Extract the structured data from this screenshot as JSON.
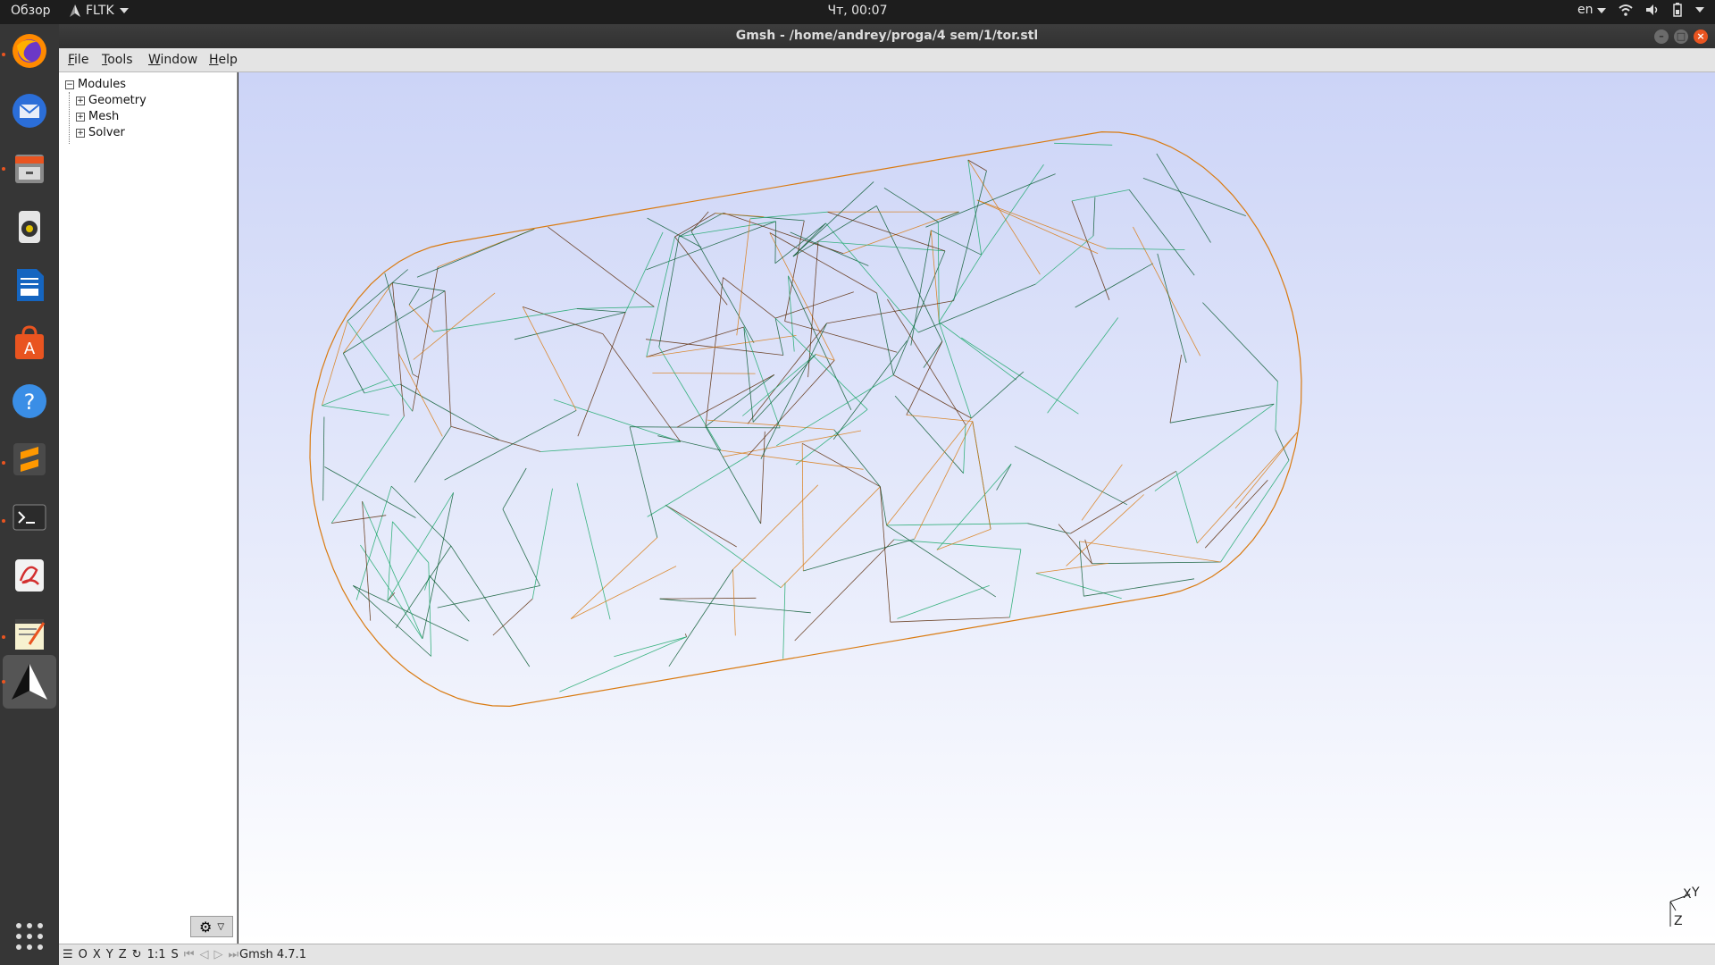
{
  "topbar": {
    "overview": "Обзор",
    "app_name": "FLTK",
    "clock": "Чт, 00:07",
    "lang": "en"
  },
  "window": {
    "title": "Gmsh - /home/andrey/proga/4 sem/1/tor.stl"
  },
  "menu": {
    "file": "File",
    "tools": "Tools",
    "window": "Window",
    "help": "Help"
  },
  "tree": {
    "root": "Modules",
    "items": [
      "Geometry",
      "Mesh",
      "Solver"
    ]
  },
  "axes": {
    "x": "X",
    "y": "Y",
    "z": "Z"
  },
  "status": {
    "o": "O",
    "x": "X",
    "y": "Y",
    "z": "Z",
    "scale": "1:1",
    "s": "S",
    "version": "Gmsh 4.7.1"
  },
  "dock": {
    "icons": [
      "firefox-icon",
      "thunderbird-icon",
      "files-icon",
      "rhythmbox-icon",
      "writer-icon",
      "software-center-icon",
      "help-icon",
      "sublime-text-icon",
      "terminal-icon",
      "document-viewer-icon",
      "text-editor-icon",
      "gmsh-icon",
      "show-apps-icon"
    ]
  },
  "colors": {
    "mesh_green": "#1aa86a",
    "mesh_dark_green": "#0b5a33",
    "mesh_orange": "#d97a10",
    "mesh_brown": "#5a2a08",
    "bg_top": "#ccd4f7",
    "bg_bottom": "#ffffff"
  }
}
